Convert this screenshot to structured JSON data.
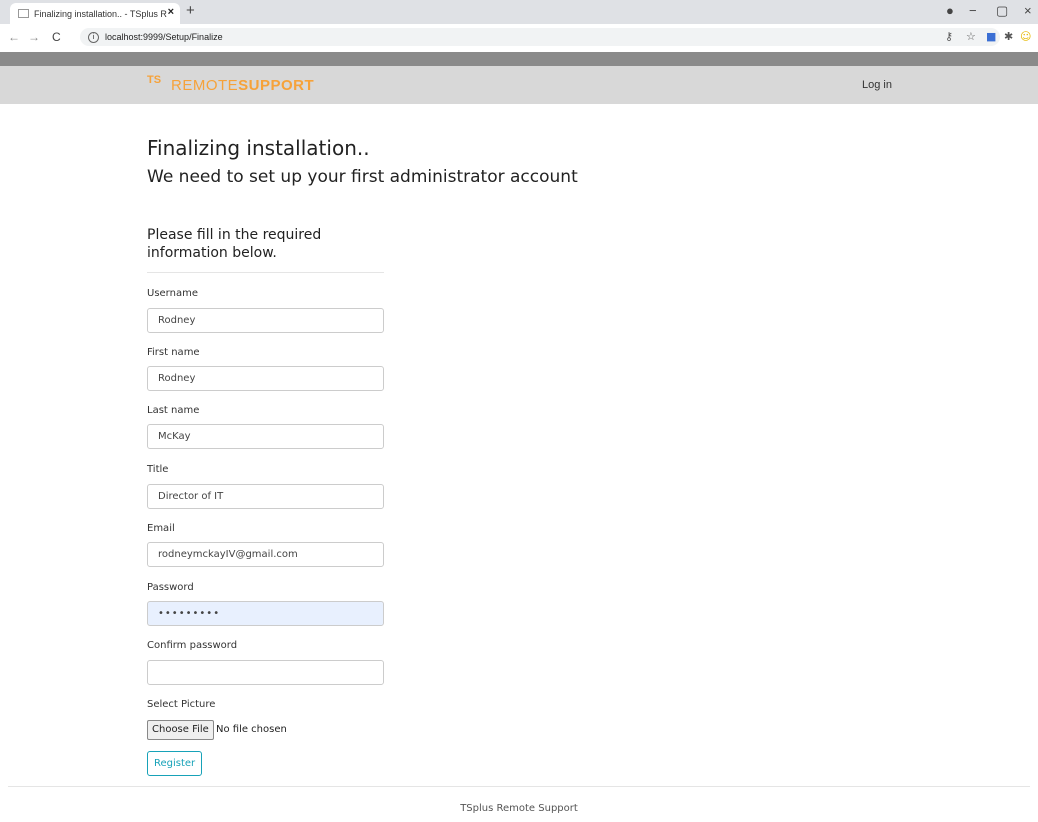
{
  "browser": {
    "tab_title": "Finalizing installation.. - TSplus R",
    "tab_close": "×",
    "new_tab": "+",
    "url": "localhost:9999/Setup/Finalize",
    "back": "←",
    "forward": "→",
    "reload": "C",
    "minimize": "−",
    "maximize": "▢",
    "close": "×"
  },
  "navbar": {
    "logo_mark": "TS",
    "brand_part1": "REMOTE",
    "brand_part2": "SUPPORT",
    "login_label": "Log in"
  },
  "main": {
    "title": "Finalizing installation..",
    "subtitle": "We need to set up your first administrator account",
    "form_heading": "Please fill in the required information below."
  },
  "form": {
    "fields": [
      {
        "label": "Username",
        "value": "Rodney"
      },
      {
        "label": "First name",
        "value": "Rodney"
      },
      {
        "label": "Last name",
        "value": "McKay"
      },
      {
        "label": "Title",
        "value": "Director of IT"
      },
      {
        "label": "Email",
        "value": "rodneymckayIV@gmail.com"
      },
      {
        "label": "Password",
        "value": "•••••••••"
      },
      {
        "label": "Confirm password",
        "value": ""
      }
    ],
    "picture_label": "Select Picture",
    "choose_file": "Choose File",
    "no_file": "No file chosen",
    "register": "Register"
  },
  "footer": {
    "text": "TSplus Remote Support"
  },
  "colors": {
    "accent_orange": "#f6a23a",
    "button_teal": "#17a2b8",
    "navbar_bg": "#d8d8d8",
    "autofill_bg": "#e8f0fe"
  }
}
